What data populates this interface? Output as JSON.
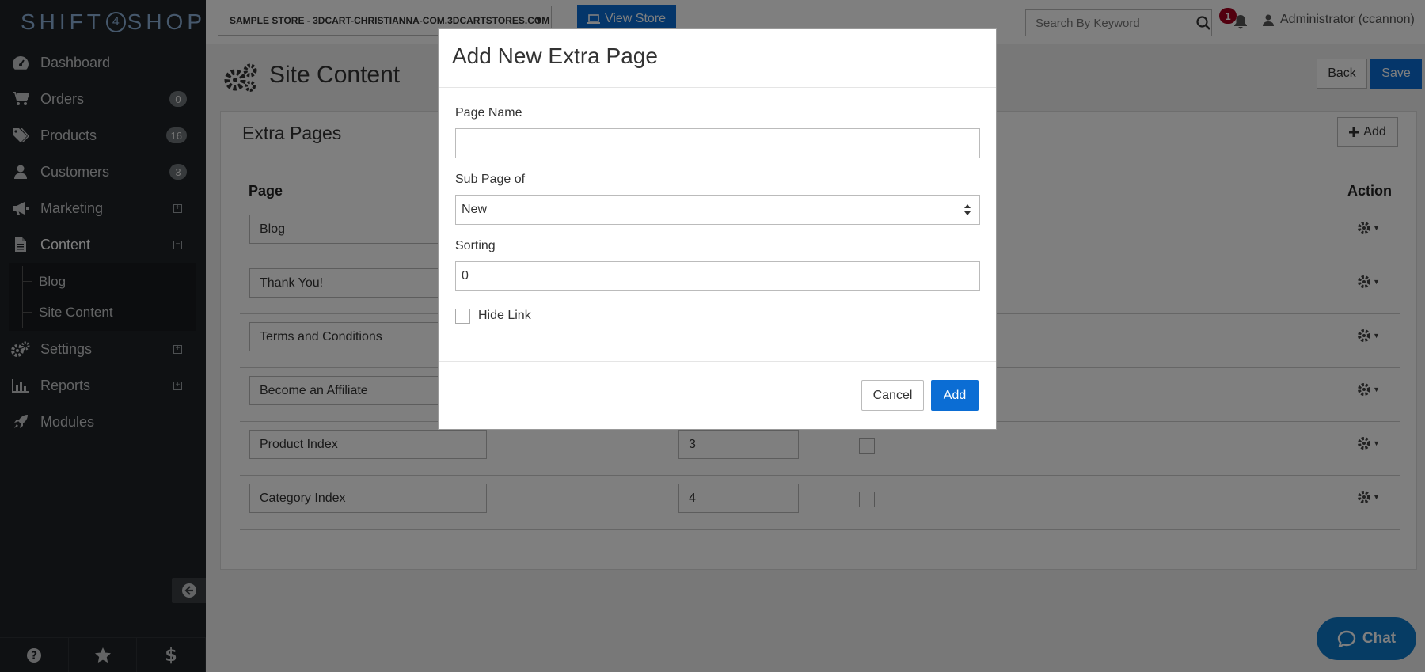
{
  "brand": {
    "logo_left": "SHIFT",
    "logo_mid": "4",
    "logo_right": "SHOP"
  },
  "sidebar": {
    "items": [
      {
        "label": "Dashboard",
        "icon": "dashboard-icon"
      },
      {
        "label": "Orders",
        "icon": "cart-icon",
        "badge": "0"
      },
      {
        "label": "Products",
        "icon": "tags-icon",
        "badge": "16"
      },
      {
        "label": "Customers",
        "icon": "user-icon",
        "badge": "3"
      },
      {
        "label": "Marketing",
        "icon": "megaphone-icon",
        "expander": "+"
      },
      {
        "label": "Content",
        "icon": "document-icon",
        "expander": "−"
      },
      {
        "label": "Settings",
        "icon": "gears-icon",
        "expander": "+"
      },
      {
        "label": "Reports",
        "icon": "bar-chart-icon",
        "expander": "+"
      },
      {
        "label": "Modules",
        "icon": "rocket-icon"
      }
    ],
    "subitems": [
      {
        "label": "Blog"
      },
      {
        "label": "Site Content"
      }
    ]
  },
  "topbar": {
    "store_name": "SAMPLE STORE - 3DCART-CHRISTIANNA-COM.3DCARTSTORES.COM",
    "view_store_label": "View Store",
    "search_placeholder": "Search By Keyword",
    "notification_count": "1",
    "user_label": "Administrator (ccannon)"
  },
  "page": {
    "title": "Site Content",
    "back_label": "Back",
    "save_label": "Save",
    "panel_title": "Extra Pages",
    "add_label": "Add",
    "col_page": "Page",
    "col_action": "Action",
    "rows": [
      {
        "page": "Blog"
      },
      {
        "page": "Thank You!"
      },
      {
        "page": "Terms and Conditions"
      },
      {
        "page": "Become an Affiliate"
      },
      {
        "page": "Product Index",
        "sorting": "3"
      },
      {
        "page": "Category Index",
        "sorting": "4"
      }
    ]
  },
  "modal": {
    "title": "Add New Extra Page",
    "page_name_label": "Page Name",
    "page_name_value": "",
    "sub_page_label": "Sub Page of",
    "sub_page_value": "New",
    "sorting_label": "Sorting",
    "sorting_value": "0",
    "hide_link_label": "Hide Link",
    "cancel_label": "Cancel",
    "add_label": "Add"
  },
  "chat": {
    "label": "Chat"
  },
  "colors": {
    "primary": "#0b6dd4",
    "sidebar_bg": "#1f2326",
    "badge_red": "#a4001f",
    "chat_bg": "#0d78c9"
  }
}
